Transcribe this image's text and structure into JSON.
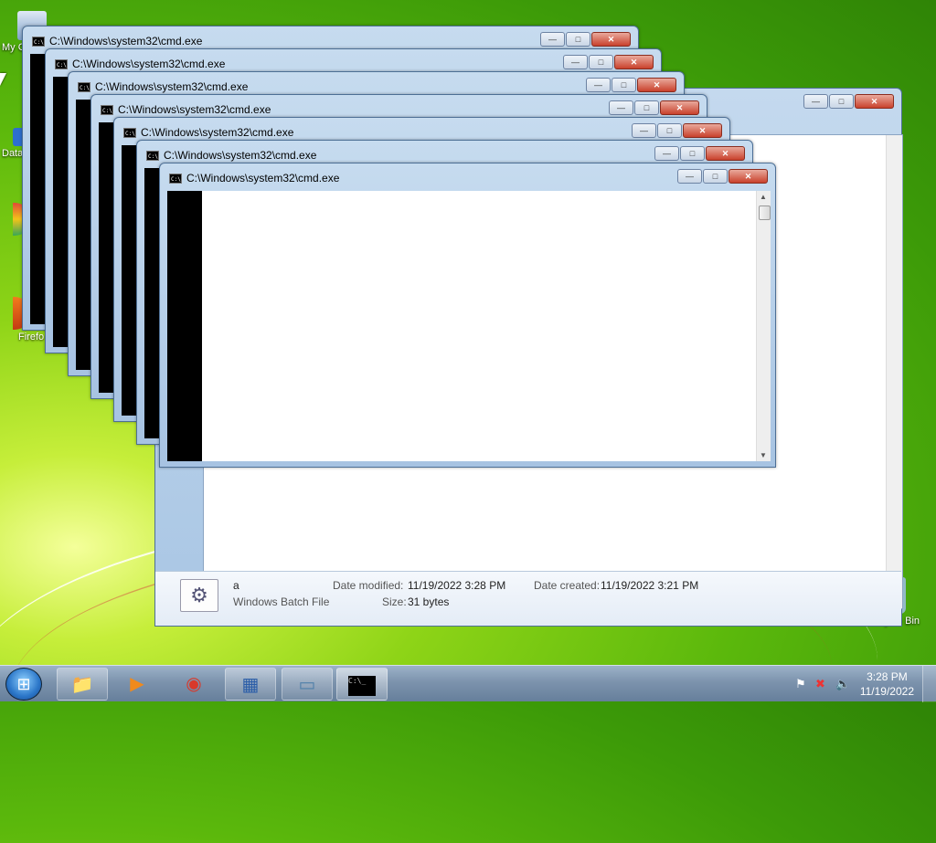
{
  "desktop": {
    "icons": [
      {
        "label": "My C",
        "icon": "computer-icon"
      },
      {
        "label": "Data",
        "icon": "shortcut-icon"
      },
      {
        "label": "",
        "icon": "chrome-shortcut-icon"
      },
      {
        "label": "Firefo",
        "icon": "firefox-icon"
      },
      {
        "label": "Recycle Bin",
        "icon": "recycle-bin-icon"
      }
    ]
  },
  "cmd": {
    "title": "C:\\Windows\\system32\\cmd.exe",
    "icon_glyph": "C:\\",
    "minimize": "—",
    "maximize": "□",
    "close": "✕",
    "scroll_up": "▲",
    "scroll_down": "▼"
  },
  "explorer": {
    "minimize": "—",
    "maximize": "□",
    "close": "✕",
    "details": {
      "file_name": "a",
      "file_type": "Windows Batch File",
      "date_modified_label": "Date modified:",
      "date_modified": "11/19/2022 3:28 PM",
      "date_created_label": "Date created:",
      "date_created": "11/19/2022 3:21 PM",
      "size_label": "Size:",
      "size": "31 bytes"
    }
  },
  "taskbar": {
    "start_glyph": "⊞",
    "buttons": [
      {
        "name": "explorer",
        "icon": "folder-icon",
        "glyph": "📁"
      },
      {
        "name": "media-player",
        "icon": "media-player-icon",
        "glyph": "▶"
      },
      {
        "name": "chrome",
        "icon": "chrome-icon",
        "glyph": "◉"
      },
      {
        "name": "control-panel",
        "icon": "control-panel-icon",
        "glyph": "▦"
      },
      {
        "name": "notepad",
        "icon": "notepad-icon",
        "glyph": "▭"
      },
      {
        "name": "cmd",
        "icon": "cmd-icon",
        "glyph": "C:\\_"
      }
    ],
    "clock_time": "3:28 PM",
    "clock_date": "11/19/2022"
  }
}
